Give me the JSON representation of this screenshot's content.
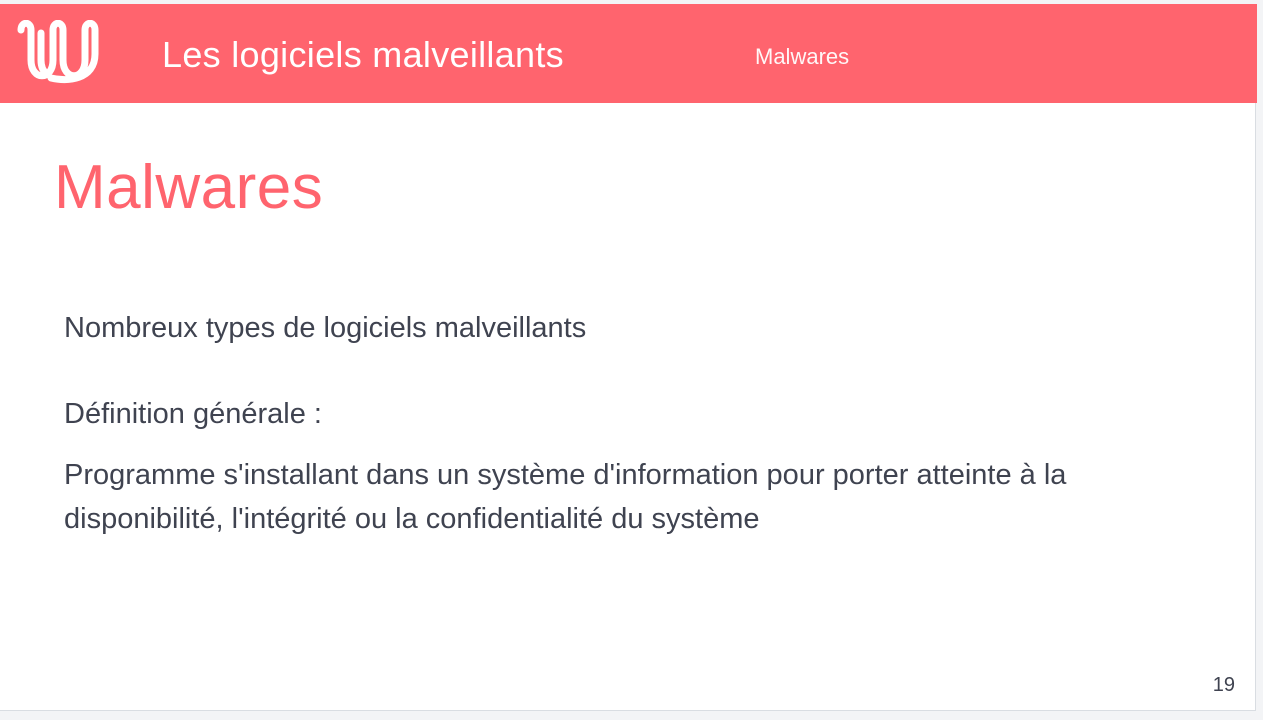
{
  "header": {
    "logo_icon": "wave-logo-icon",
    "title": "Les logiciels malveillants",
    "section": "Malwares"
  },
  "slide": {
    "title": "Malwares",
    "paragraphs": [
      "Nombreux types de logiciels malveillants",
      "Définition générale :",
      "Programme s'installant dans un système d'information pour porter atteinte à la disponibilité, l'intégrité ou la confidentialité du système"
    ],
    "page_number": "19"
  },
  "colors": {
    "accent": "#ff646e",
    "text": "#3f4350",
    "background": "#ffffff"
  }
}
